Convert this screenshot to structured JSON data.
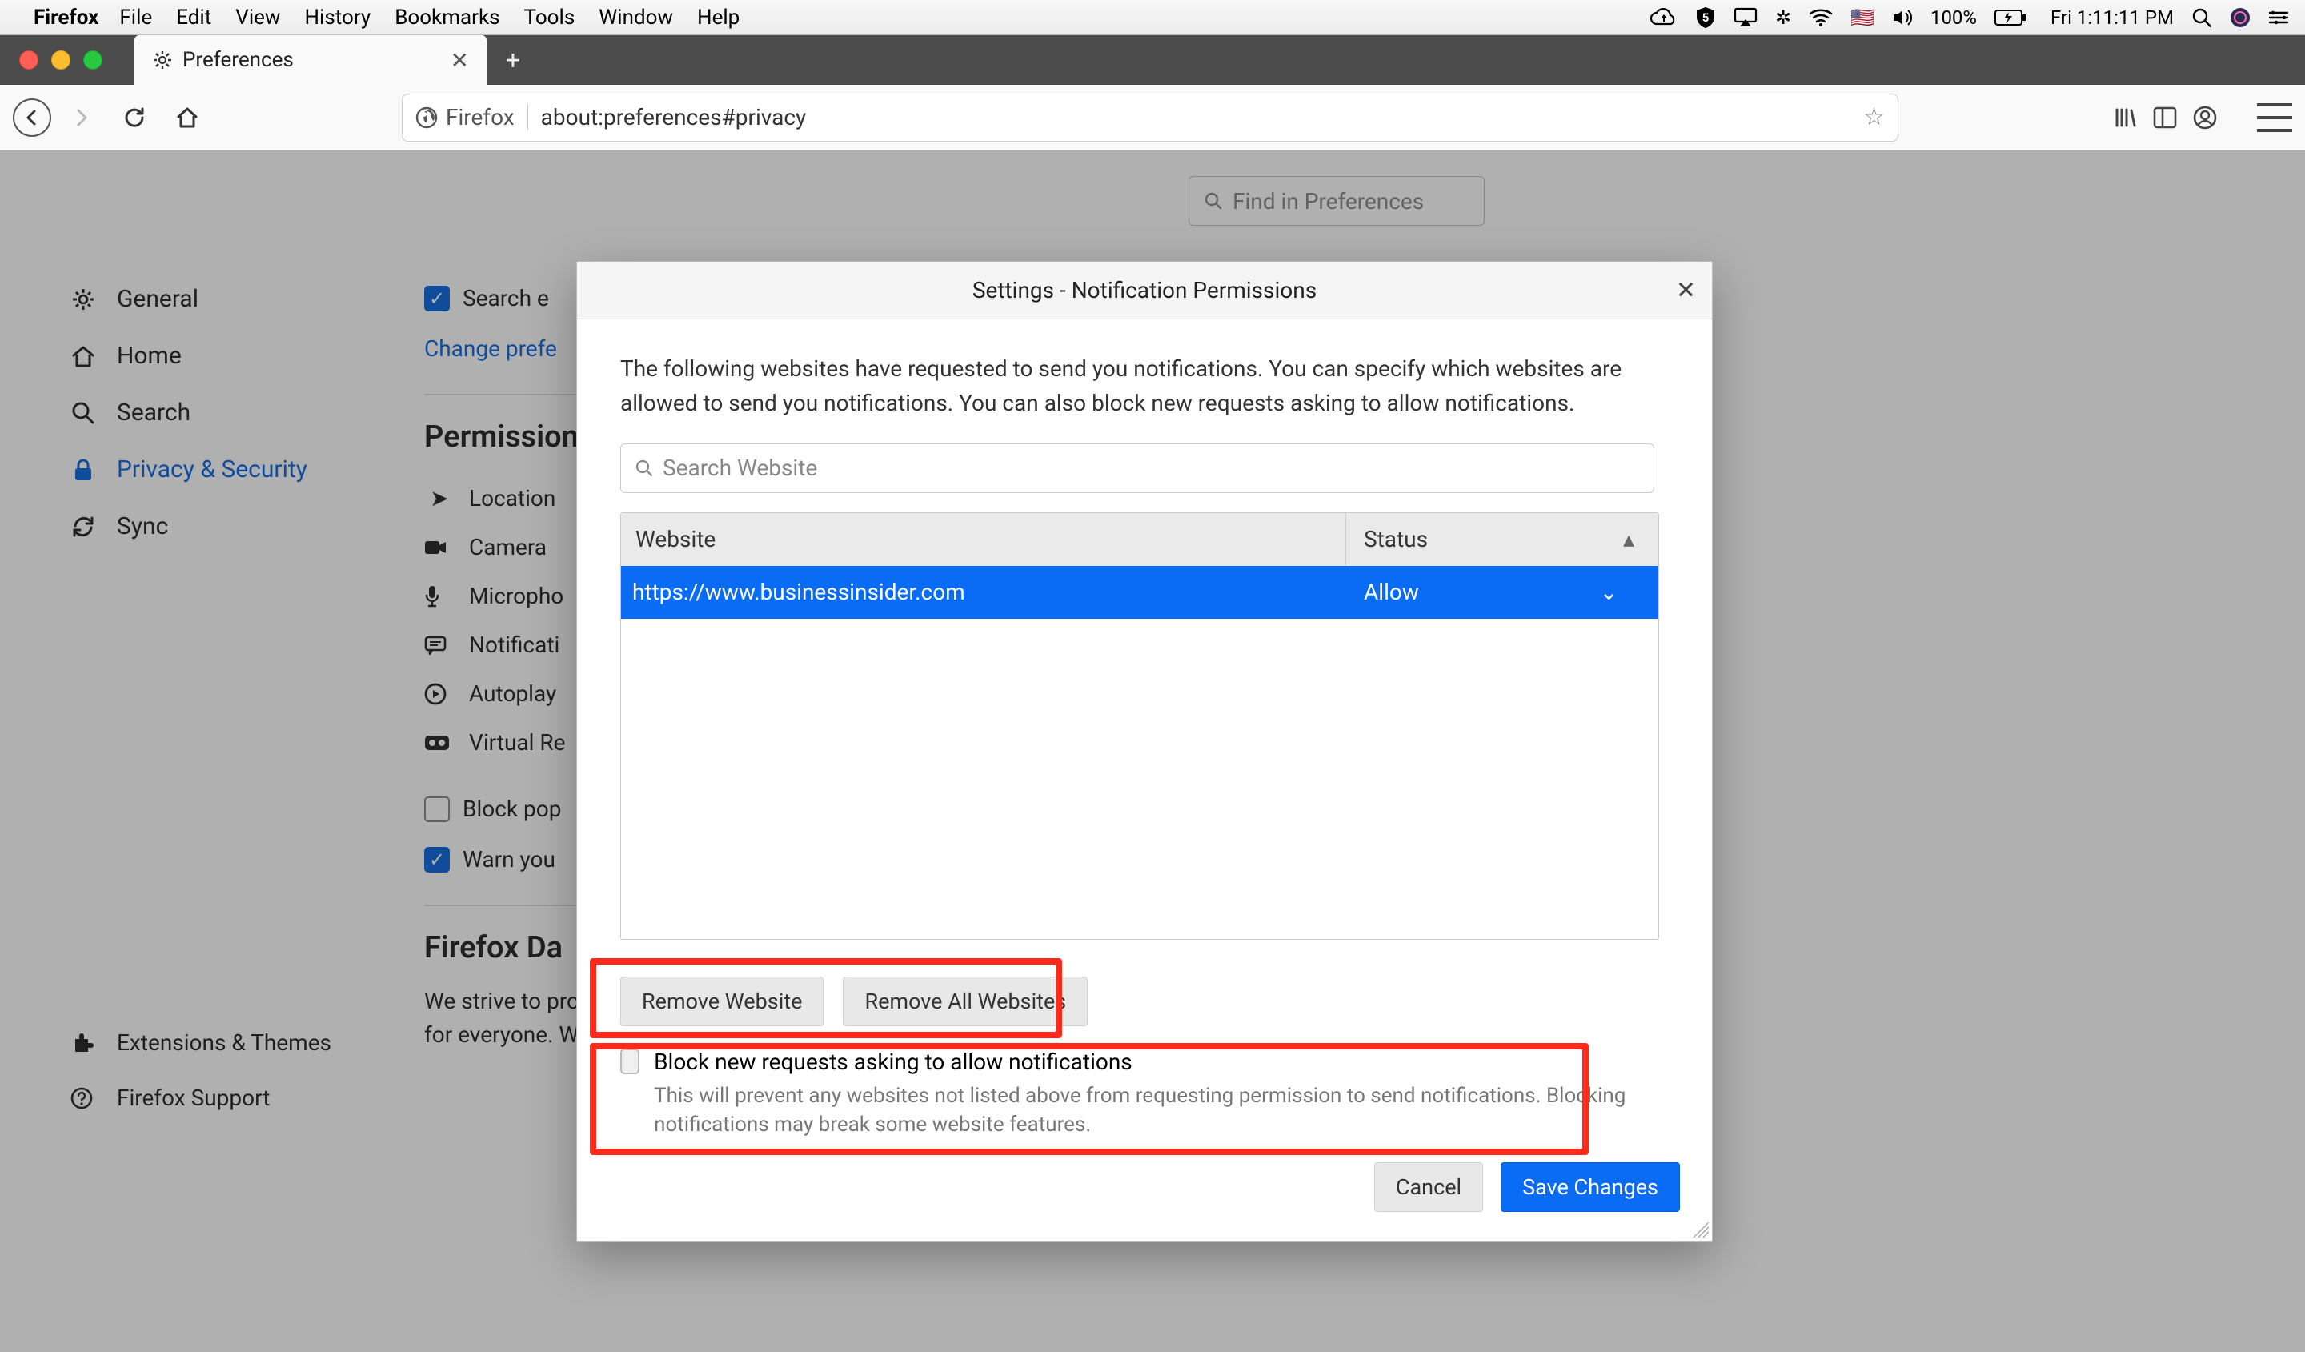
{
  "menubar": {
    "appname": "Firefox",
    "items": [
      "File",
      "Edit",
      "View",
      "History",
      "Bookmarks",
      "Tools",
      "Window",
      "Help"
    ],
    "battery": "100%",
    "clock": "Fri 1:11:11 PM"
  },
  "tab": {
    "title": "Preferences"
  },
  "urlbar": {
    "brand": "Firefox",
    "url": "about:preferences#privacy"
  },
  "prefs": {
    "search_placeholder": "Find in Preferences",
    "nav": {
      "general": "General",
      "home": "Home",
      "search": "Search",
      "privacy": "Privacy & Security",
      "sync": "Sync",
      "extensions": "Extensions & Themes",
      "support": "Firefox Support"
    },
    "engines_label": "Search e",
    "change_link": "Change prefe",
    "permissions_title": "Permission",
    "perms": {
      "location": "Location",
      "camera": "Camera",
      "microphone": "Micropho",
      "notifications": "Notificati",
      "autoplay": "Autoplay",
      "vr": "Virtual Re"
    },
    "block_pop": "Block pop",
    "warn_you": "Warn you",
    "firefox_data": "Firefox Da",
    "data_text": "We strive to provide you with choices and collect only what we need to provide and improve Firefox for everyone. We always ask permission before receiving personal information."
  },
  "modal": {
    "title": "Settings - Notification Permissions",
    "desc": "The following websites have requested to send you notifications. You can specify which websites are allowed to send you notifications. You can also block new requests asking to allow notifications.",
    "search_placeholder": "Search Website",
    "col_website": "Website",
    "col_status": "Status",
    "rows": [
      {
        "site": "https://www.businessinsider.com",
        "status": "Allow"
      }
    ],
    "remove_website": "Remove Website",
    "remove_all": "Remove All Websites",
    "block_label": "Block new requests asking to allow notifications",
    "block_desc": "This will prevent any websites not listed above from requesting permission to send notifications. Blocking notifications may break some website features.",
    "cancel": "Cancel",
    "save": "Save Changes"
  }
}
